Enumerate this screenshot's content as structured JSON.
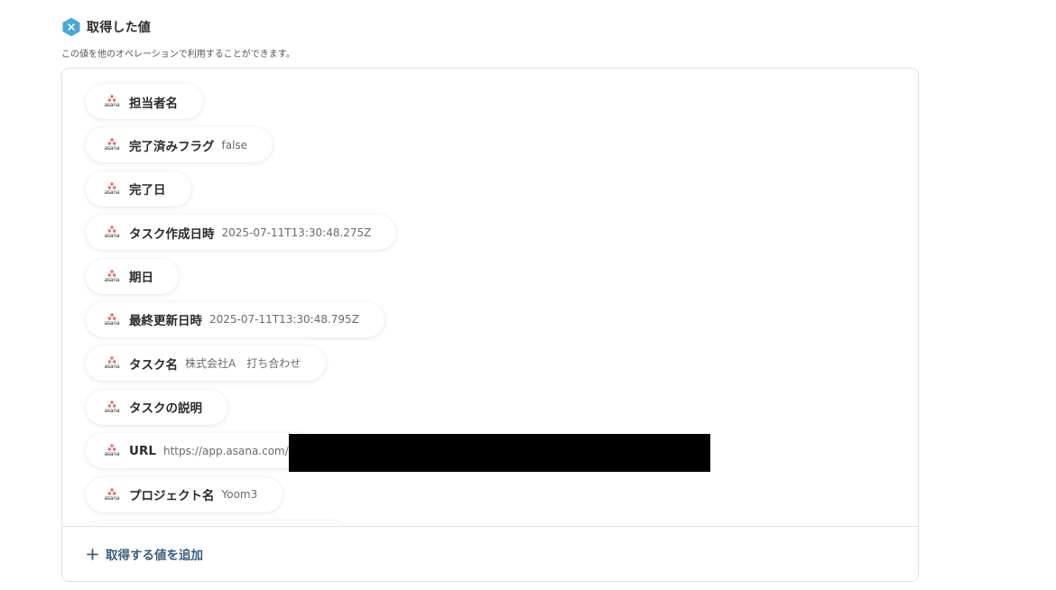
{
  "header": {
    "title": "取得した値",
    "description": "この値を他のオペレーションで利用することができます。",
    "icon": "variable-x-icon"
  },
  "asana": {
    "word": "asana",
    "brand_color": "#f06a6a"
  },
  "items": [
    {
      "label": "担当者名",
      "value": ""
    },
    {
      "label": "完了済みフラグ",
      "value": "false"
    },
    {
      "label": "完了日",
      "value": ""
    },
    {
      "label": "タスク作成日時",
      "value": "2025-07-11T13:30:48.275Z"
    },
    {
      "label": "期日",
      "value": ""
    },
    {
      "label": "最終更新日時",
      "value": "2025-07-11T13:30:48.795Z"
    },
    {
      "label": "タスク名",
      "value": "株式会社A　打ち合わせ"
    },
    {
      "label": "タスクの説明",
      "value": ""
    },
    {
      "label": "URL",
      "value": "https://app.asana.com/"
    },
    {
      "label": "プロジェクト名",
      "value": "Yoom3"
    },
    {
      "label": "",
      "value": ""
    }
  ],
  "footer": {
    "add_label": "取得する値を追加"
  },
  "colors": {
    "accent": "#3a5e7a",
    "icon_bg": "#4aa8d8",
    "border": "#dcdfe3"
  }
}
